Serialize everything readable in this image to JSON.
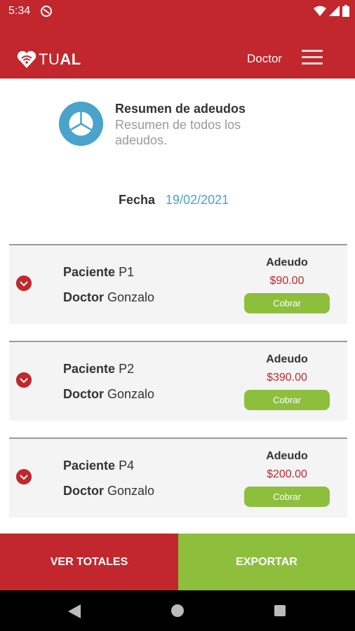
{
  "status_bar": {
    "time": "5:34"
  },
  "app_bar": {
    "logo_text_light": "TU",
    "logo_text_bold": "AL",
    "role": "Doctor"
  },
  "summary": {
    "title": "Resumen de adeudos",
    "subtitle": "Resumen de todos los adeudos."
  },
  "fecha": {
    "label": "Fecha",
    "value": "19/02/2021"
  },
  "cards": [
    {
      "paciente_label": "Paciente",
      "paciente": "P1",
      "doctor_label": "Doctor",
      "doctor": "Gonzalo",
      "adeudo_label": "Adeudo",
      "amount": "$90.00",
      "button": "Cobrar"
    },
    {
      "paciente_label": "Paciente",
      "paciente": "P2",
      "doctor_label": "Doctor",
      "doctor": "Gonzalo",
      "adeudo_label": "Adeudo",
      "amount": "$390.00",
      "button": "Cobrar"
    },
    {
      "paciente_label": "Paciente",
      "paciente": "P4",
      "doctor_label": "Doctor",
      "doctor": "Gonzalo",
      "adeudo_label": "Adeudo",
      "amount": "$200.00",
      "button": "Cobrar"
    }
  ],
  "actions": {
    "ver_totales": "VER TOTALES",
    "exportar": "EXPORTAR"
  },
  "colors": {
    "primary_red": "#c1272d",
    "accent_green": "#8dbf3d",
    "accent_blue": "#4aa3cb"
  },
  "icons": {
    "summary": "pie-chart-icon",
    "card_check": "chevron-down-circle-icon",
    "menu": "hamburger-menu-icon",
    "logo": "heart-wifi-icon"
  }
}
